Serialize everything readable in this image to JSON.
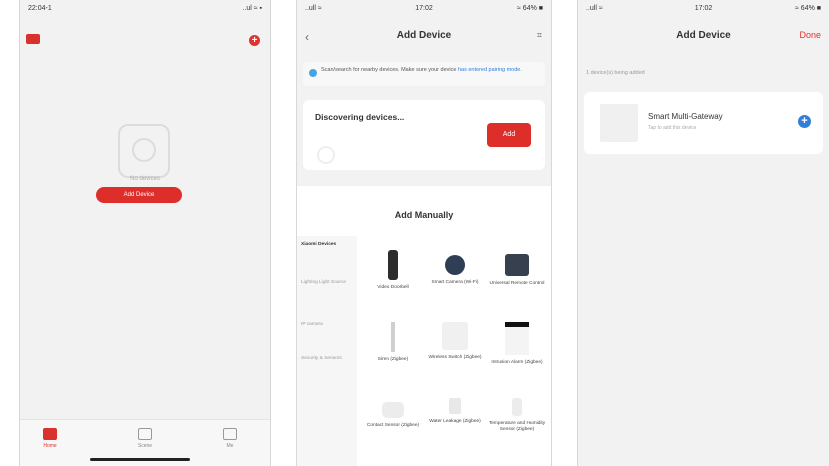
{
  "screen1": {
    "status": {
      "time": "22:04-1",
      "right": "..ul ≈ ▪"
    },
    "empty_text": "No devices",
    "add_button": "Add Device",
    "tabs": [
      {
        "label": "Home",
        "icon": "home-icon"
      },
      {
        "label": "Scene",
        "icon": "scene-icon"
      },
      {
        "label": "Me",
        "icon": "profile-icon"
      }
    ]
  },
  "screen2": {
    "status": {
      "left": "..ull ≈",
      "time": "17:02",
      "right": "≈ 64% ■"
    },
    "title": "Add Device",
    "tip_text": "Scan/search for nearby devices. Make sure your device",
    "tip_link": "has entered pairing mode.",
    "discover_label": "Discovering devices...",
    "add_label": "Add",
    "manual_title": "Add Manually",
    "categories": [
      "Xiaomi Devices",
      "Lighting Light Source",
      "IP camera",
      "Security & Sensors"
    ],
    "devices": [
      [
        "Video Doorbell",
        "Smart Camera (Wi-Fi)",
        "Universal Remote Control"
      ],
      [
        "Siren (Zigbee)",
        "Wireless Switch (Zigbee)",
        "Intrusion Alarm (Zigbee)"
      ],
      [
        "Contact Sensor (Zigbee)",
        "Water Leakage (Zigbee)",
        "Temperature and Humidity Sensor (Zigbee)"
      ]
    ]
  },
  "screen3": {
    "status": {
      "left": "..ull ≈",
      "time": "17:02",
      "right": "≈ 64% ■"
    },
    "title": "Add Device",
    "done": "Done",
    "subtitle": "1 device(s) being added",
    "device_name": "Smart Multi-Gateway",
    "device_desc": "Tap to add this device"
  },
  "colors": {
    "accent": "#dd2e2a",
    "blue": "#2f7fd8"
  }
}
